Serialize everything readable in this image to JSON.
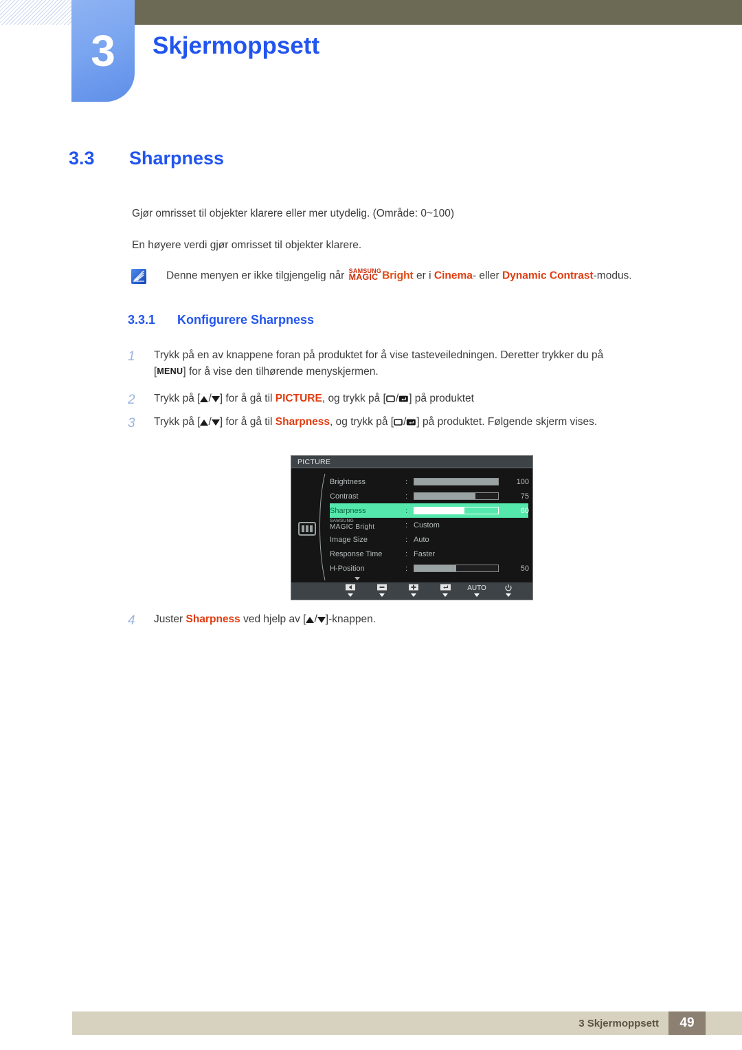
{
  "header": {
    "chapter_number": "3",
    "chapter_title": "Skjermoppsett"
  },
  "section": {
    "number": "3.3",
    "title": "Sharpness"
  },
  "paragraphs": {
    "p1": "Gjør omrisset til objekter klarere eller mer utydelig. (Område: 0~100)",
    "p2": "En høyere verdi gjør omrisset til objekter klarere."
  },
  "note": {
    "icon": "note-pencil-icon",
    "text_before": "Denne menyen er ikke tilgjengelig når",
    "magic_top": "SAMSUNG",
    "magic_bottom": "MAGIC",
    "bright": "Bright",
    "text_mid": "er i",
    "cinema": "Cinema",
    "text_or": "- eller",
    "dynamic_contrast": "Dynamic Contrast",
    "text_after": "-modus."
  },
  "subsection": {
    "number": "3.3.1",
    "title": "Konfigurere Sharpness"
  },
  "steps": [
    {
      "num": "1",
      "part_a": "Trykk på en av knappene foran på produktet for å vise tasteveiledningen. Deretter trykker du på",
      "key": "MENU",
      "part_b": "for å vise den tilhørende menyskjermen."
    },
    {
      "num": "2",
      "part_a": "Trykk på [",
      "sep": "/",
      "part_b": "] for å gå til",
      "highlight": "PICTURE",
      "part_c": ", og trykk på [",
      "part_d": "] på produktet"
    },
    {
      "num": "3",
      "part_a": "Trykk på [",
      "sep": "/",
      "part_b": "] for å gå til",
      "highlight": "Sharpness",
      "part_c": ", og trykk på [",
      "part_d": "] på produktet. Følgende skjerm vises."
    },
    {
      "num": "4",
      "part_a": "Juster",
      "highlight": "Sharpness",
      "part_b": "ved hjelp av [",
      "sep": "/",
      "part_c": "]-knappen."
    }
  ],
  "osd": {
    "title": "PICTURE",
    "category_icon": "picture-bars-icon",
    "scroll_down_icon": "chevron-down-icon",
    "rows": [
      {
        "label": "Brightness",
        "type": "bar",
        "value": 100,
        "percent": 100,
        "selected": false
      },
      {
        "label": "Contrast",
        "type": "bar",
        "value": 75,
        "percent": 73,
        "selected": false
      },
      {
        "label": "Sharpness",
        "type": "bar",
        "value": 60,
        "percent": 60,
        "selected": true
      },
      {
        "label": "MAGIC Bright",
        "label_top": "SAMSUNG",
        "label_bot": "MAGIC",
        "label_suffix": " Bright",
        "type": "text",
        "value": "Custom",
        "selected": false
      },
      {
        "label": "Image Size",
        "type": "text",
        "value": "Auto",
        "selected": false
      },
      {
        "label": "Response Time",
        "type": "text",
        "value": "Faster",
        "selected": false
      },
      {
        "label": "H-Position",
        "type": "bar",
        "value": 50,
        "percent": 50,
        "selected": false
      }
    ],
    "buttons": [
      {
        "icon": "left-arrow-icon",
        "label": ""
      },
      {
        "icon": "minus-icon",
        "label": ""
      },
      {
        "icon": "plus-icon",
        "label": ""
      },
      {
        "icon": "enter-icon",
        "label": ""
      },
      {
        "icon": "auto-text",
        "label": "AUTO"
      },
      {
        "icon": "power-icon",
        "label": ""
      }
    ]
  },
  "footer": {
    "label": "3 Skjermoppsett",
    "page_number": "49"
  },
  "colors": {
    "accent_blue": "#2255ee",
    "olive": "#6c6a54",
    "highlight_red": "#e03c10",
    "osd_selected_green": "#55e8ac",
    "footer_beige": "#d7d2bf",
    "footer_pagebox": "#8c8072"
  }
}
